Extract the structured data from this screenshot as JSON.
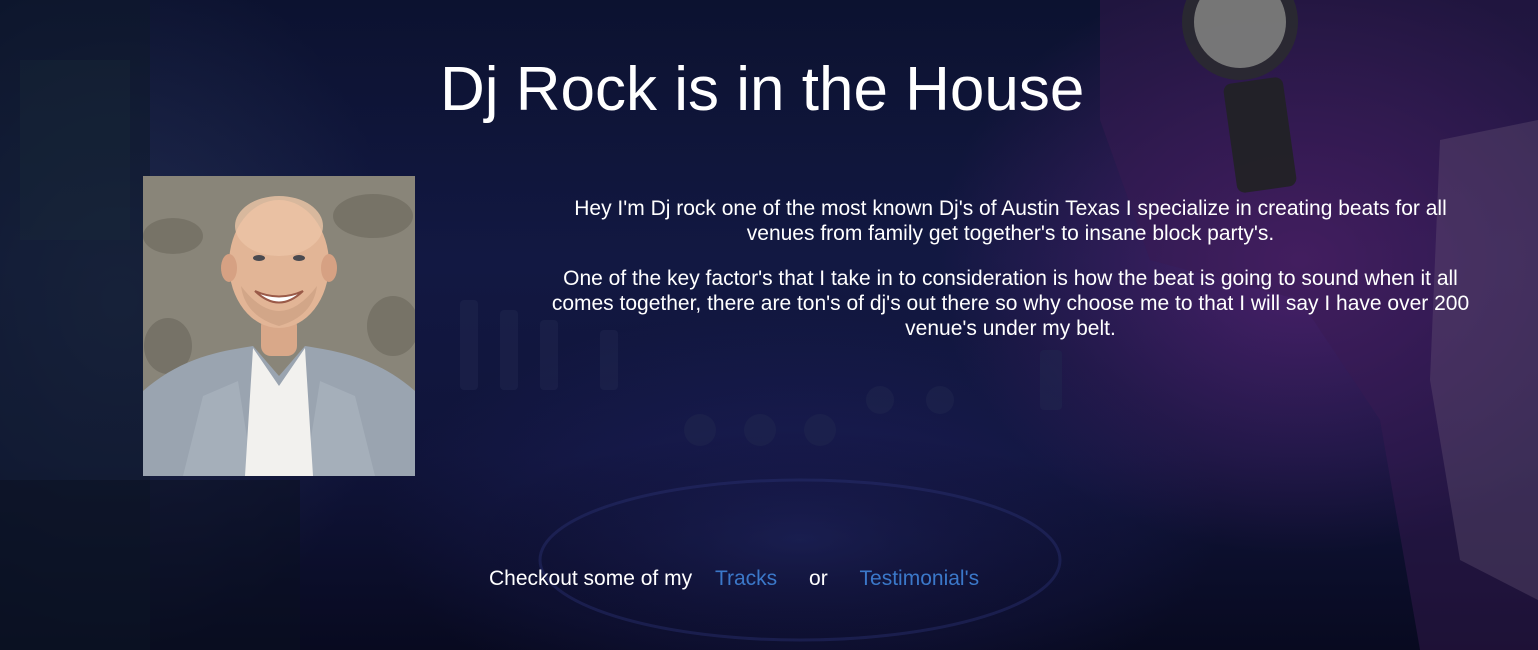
{
  "header": {
    "title": "Dj Rock is in the House"
  },
  "profile": {
    "photo_icon": "person-portrait-icon"
  },
  "bio": {
    "paragraph_1": "Hey I'm Dj rock one of the most known Dj's of Austin Texas I specialize in creating beats for all venues from family get together's to insane block party's.",
    "paragraph_2": "One of the key factor's that I take in to consideration is how the beat is going to sound when it all comes together, there are ton's of dj's out there so why choose me to that I will say I have over 200 venue's under my belt."
  },
  "cta": {
    "prefix": "Checkout some of my",
    "tracks_label": "Tracks",
    "or_label": "or",
    "testimonials_label": "Testimonial's"
  },
  "colors": {
    "background": "#10143a",
    "text": "#ffffff",
    "link": "#3b78c9"
  }
}
